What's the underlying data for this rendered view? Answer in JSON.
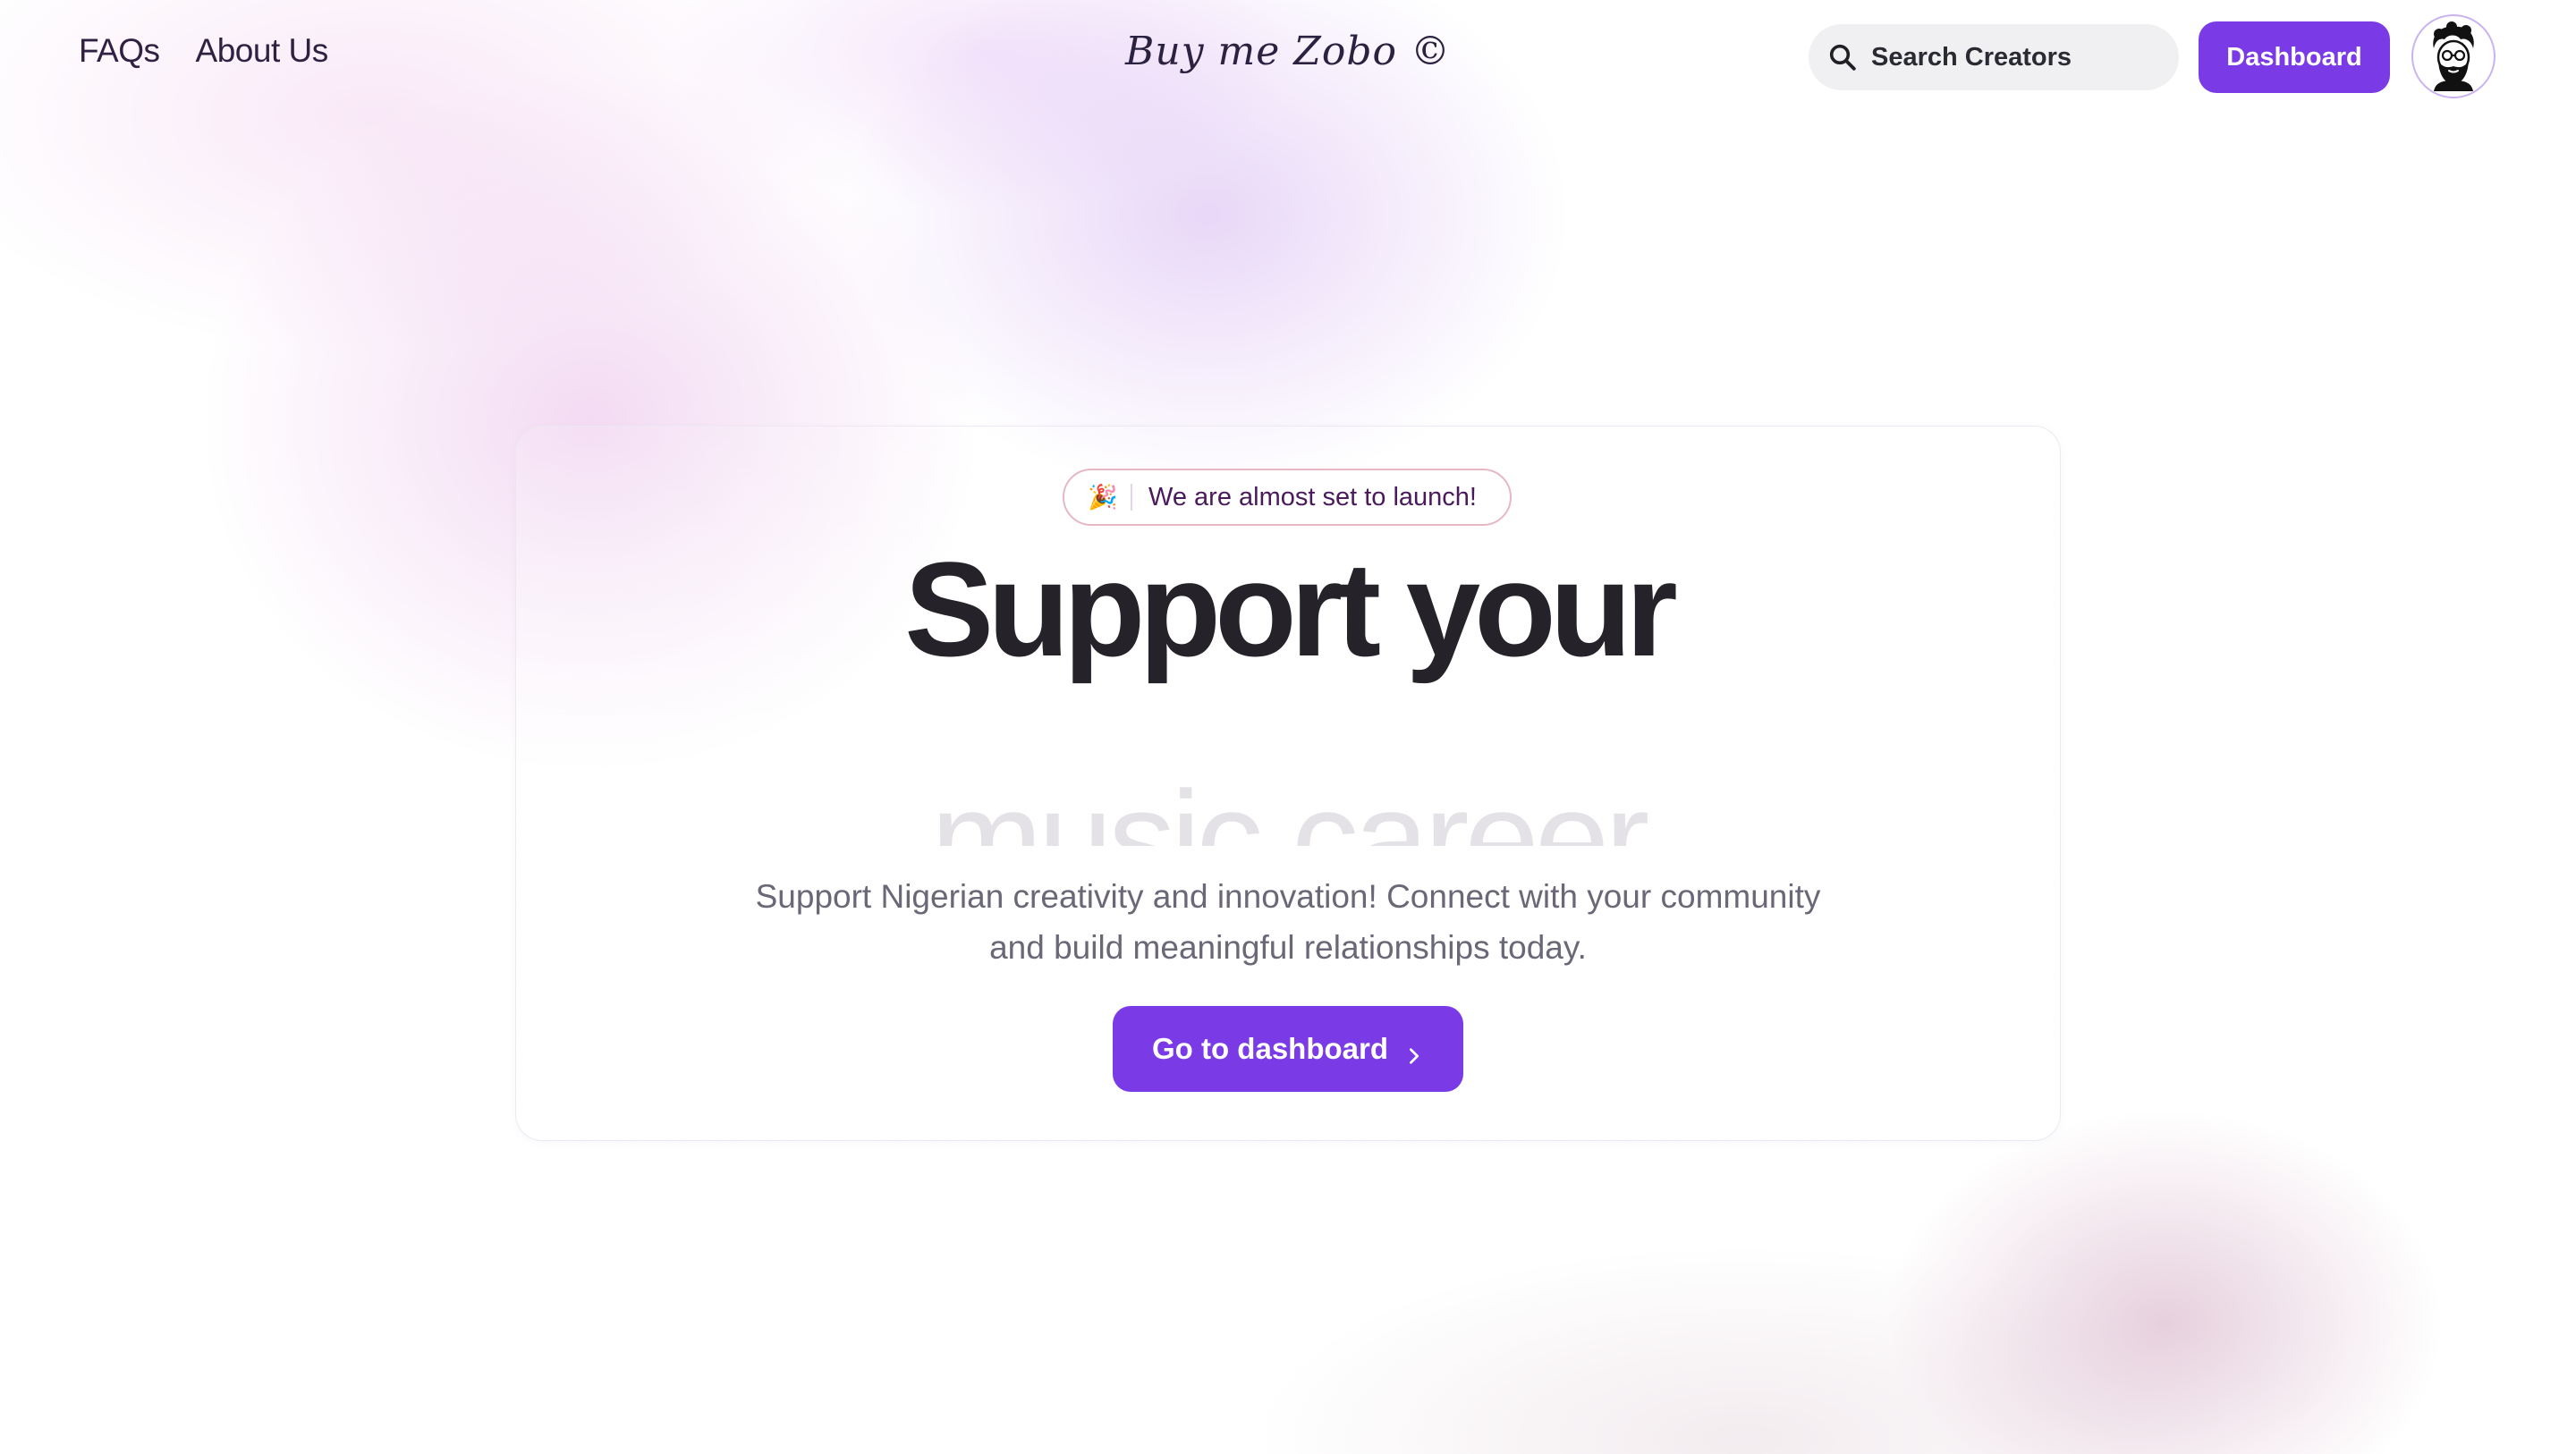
{
  "header": {
    "nav": [
      {
        "label": "FAQs"
      },
      {
        "label": "About Us"
      }
    ],
    "logo": "Buy me Zobo ©",
    "search": {
      "placeholder": "Search Creators",
      "icon": "search-icon"
    },
    "dashboard_button": "Dashboard",
    "avatar": {
      "icon": "user-avatar-icon"
    }
  },
  "hero": {
    "badge": {
      "icon": "🎉",
      "text": "We are almost set to launch!"
    },
    "title": "Support your",
    "rotating_word": "music career",
    "subtitle_line1": "Support Nigerian creativity and innovation! Connect with your community",
    "subtitle_line2": "and build meaningful relationships today.",
    "cta_label": "Go to dashboard",
    "cta_icon": "chevron-right-icon"
  },
  "colors": {
    "brand": "#7a3ae6",
    "title": "#26222a",
    "subtitle": "#6b6777",
    "badge_text": "#4a1a5c",
    "badge_border": "#e7b7c3"
  }
}
